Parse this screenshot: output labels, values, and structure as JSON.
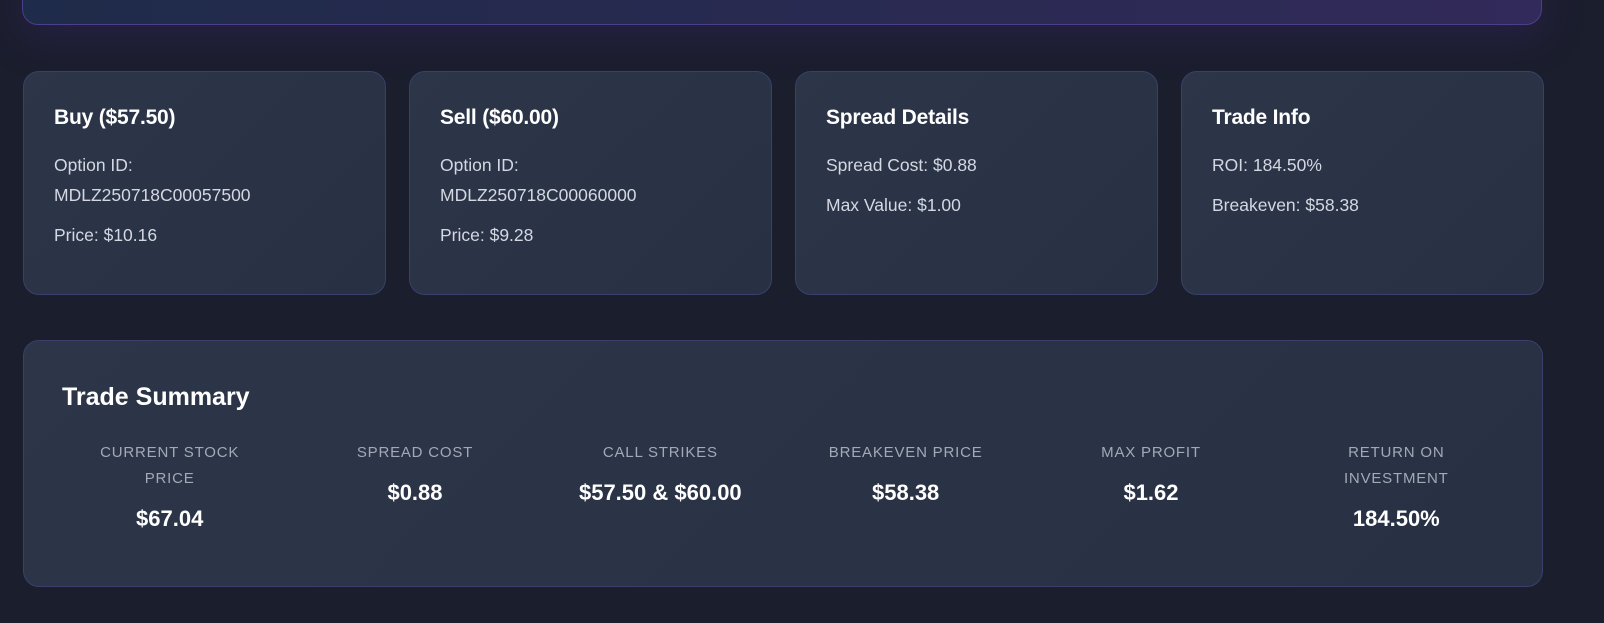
{
  "cards": [
    {
      "title": "Buy ($57.50)",
      "lines": [
        "Option ID:",
        "MDLZ250718C00057500",
        "Price: $10.16"
      ]
    },
    {
      "title": "Sell ($60.00)",
      "lines": [
        "Option ID:",
        "MDLZ250718C00060000",
        "Price: $9.28"
      ]
    },
    {
      "title": "Spread Details",
      "lines": [
        "Spread Cost: $0.88",
        "Max Value: $1.00"
      ]
    },
    {
      "title": "Trade Info",
      "lines": [
        "ROI: 184.50%",
        "Breakeven: $58.38"
      ]
    }
  ],
  "summary": {
    "title": "Trade Summary",
    "items": [
      {
        "label": "Current Stock Price",
        "value": "$67.04"
      },
      {
        "label": "Spread Cost",
        "value": "$0.88"
      },
      {
        "label": "Call Strikes",
        "value": "$57.50 & $60.00"
      },
      {
        "label": "Breakeven Price",
        "value": "$58.38"
      },
      {
        "label": "Max Profit",
        "value": "$1.62"
      },
      {
        "label": "Return on Investment",
        "value": "184.50%"
      }
    ]
  }
}
